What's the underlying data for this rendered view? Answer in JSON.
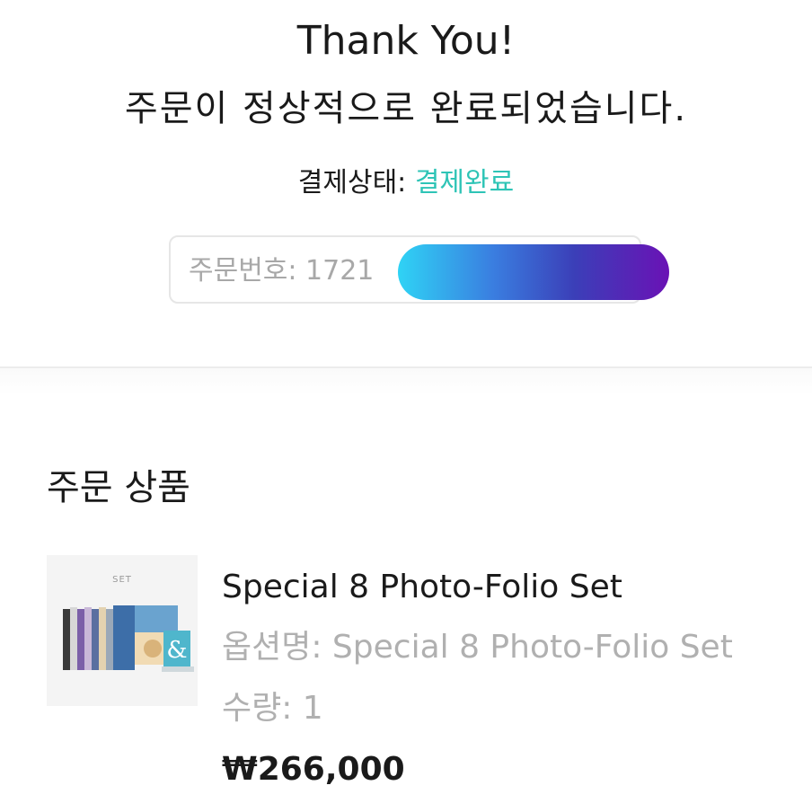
{
  "header": {
    "title": "Thank You!",
    "subtitle": "주문이 정상적으로 완료되었습니다."
  },
  "payment": {
    "status_label": "결제상태: ",
    "status_value": "결제완료",
    "status_color": "#2ec4b6"
  },
  "order": {
    "number_text": "주문번호: 1721"
  },
  "section": {
    "title": "주문 상품"
  },
  "product": {
    "thumb_caption": "SET",
    "name": "Special 8 Photo-Folio Set",
    "option": "옵션명: Special 8 Photo-Folio Set",
    "quantity": "수량: 1",
    "price": "₩266,000"
  }
}
